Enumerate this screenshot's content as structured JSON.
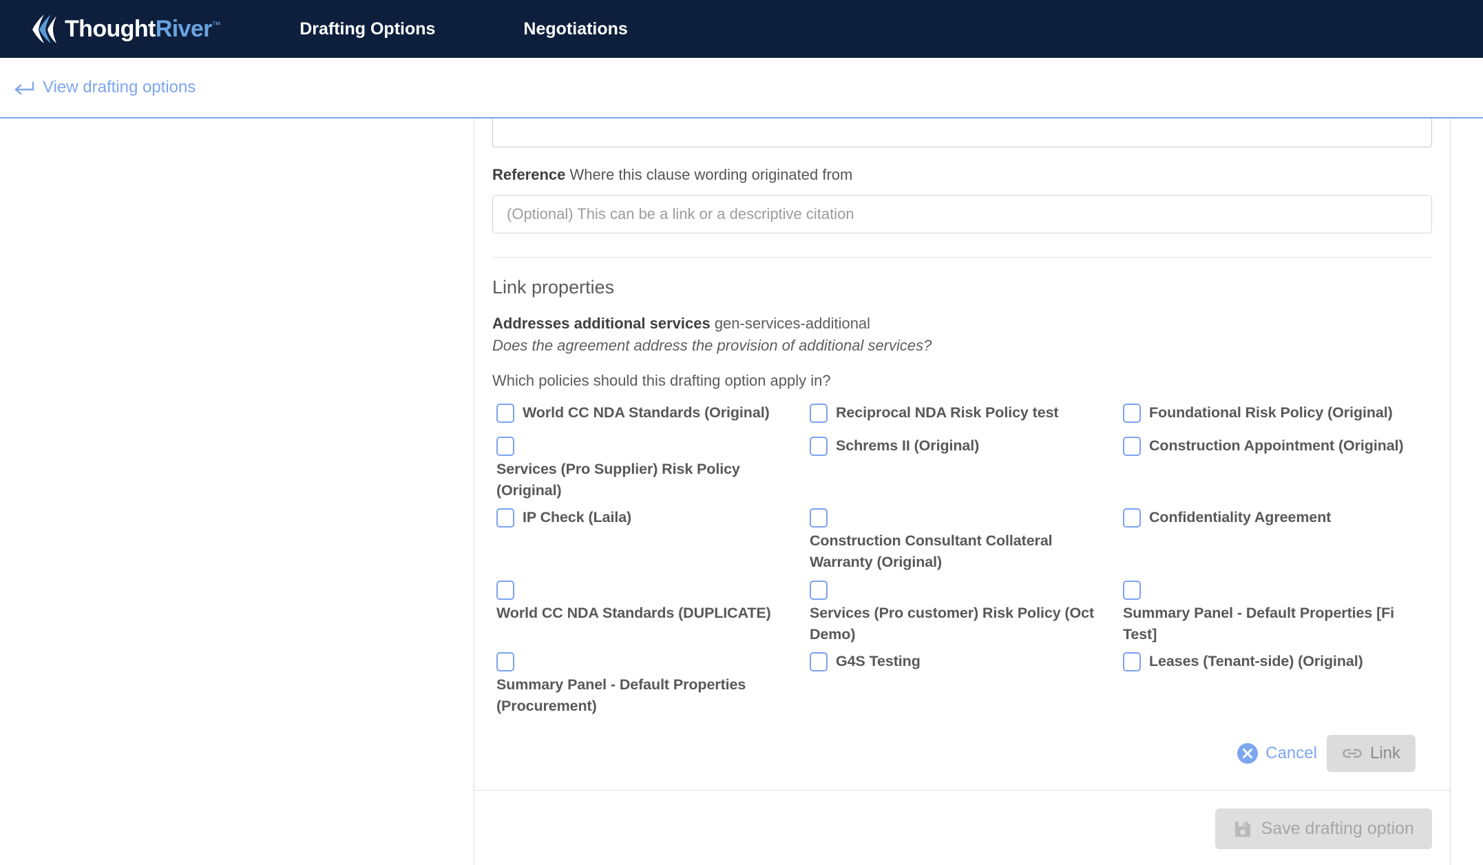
{
  "nav": {
    "logo": {
      "primary": "Thought",
      "secondary": "River",
      "tm": "™",
      "icon": "thoughtriver-logo-icon"
    },
    "links": [
      {
        "label": "Drafting Options"
      },
      {
        "label": "Negotiations"
      }
    ]
  },
  "subheader": {
    "back_link": "View drafting options",
    "back_icon": "back-arrow-icon"
  },
  "reference": {
    "label_bold": "Reference",
    "label_rest": " Where this clause wording originated from",
    "placeholder": "(Optional) This can be a link or a descriptive citation",
    "value": ""
  },
  "link_properties": {
    "title": "Link properties",
    "property_name": "Addresses additional services",
    "property_code": " gen-services-additional",
    "property_description": "Does the agreement address the provision of additional services?",
    "question": "Which policies should this drafting option apply in?",
    "policies": [
      {
        "label": "World CC NDA Standards (Original)",
        "checked": false,
        "wrap": false
      },
      {
        "label": "Reciprocal NDA Risk Policy test",
        "checked": false,
        "wrap": false
      },
      {
        "label": "Foundational Risk Policy (Original)",
        "checked": false,
        "wrap": false
      },
      {
        "label": "Services (Pro Supplier) Risk Policy (Original)",
        "checked": false,
        "wrap": true
      },
      {
        "label": "Schrems II (Original)",
        "checked": false,
        "wrap": false
      },
      {
        "label": "Construction Appointment (Original)",
        "checked": false,
        "wrap": false
      },
      {
        "label": "IP Check (Laila)",
        "checked": false,
        "wrap": false
      },
      {
        "label": "Construction Consultant Collateral Warranty (Original)",
        "checked": false,
        "wrap": true
      },
      {
        "label": "Confidentiality Agreement",
        "checked": false,
        "wrap": false
      },
      {
        "label": "World CC NDA Standards (DUPLICATE)",
        "checked": false,
        "wrap": true
      },
      {
        "label": "Services (Pro customer) Risk Policy (Oct Demo)",
        "checked": false,
        "wrap": true
      },
      {
        "label": "Summary Panel - Default Properties [Fi Test]",
        "checked": false,
        "wrap": true
      },
      {
        "label": "Summary Panel - Default Properties (Procurement)",
        "checked": false,
        "wrap": true
      },
      {
        "label": "G4S Testing",
        "checked": false,
        "wrap": false
      },
      {
        "label": "Leases (Tenant-side) (Original)",
        "checked": false,
        "wrap": false
      }
    ],
    "cancel_label": "Cancel",
    "cancel_icon": "close-circle-icon",
    "link_label": "Link",
    "link_icon": "chain-link-icon"
  },
  "footer": {
    "save_label": "Save drafting option",
    "save_icon": "floppy-disk-icon"
  },
  "colors": {
    "nav_background": "#0d1f3c",
    "accent_blue": "#7da6f0",
    "logo_river": "#6ba3e0",
    "checkbox_border": "#7ba2ef",
    "disabled_button": "#dcdcdc",
    "text_gray": "#585858"
  }
}
